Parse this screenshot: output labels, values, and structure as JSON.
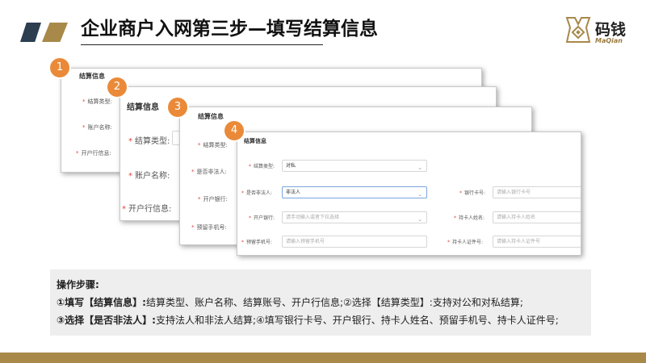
{
  "header": {
    "title": "企业商户入网第三步—填写结算信息",
    "logo_cn": "码钱",
    "logo_en": "MaQian"
  },
  "colors": {
    "accent_gold": "#a8894a",
    "accent_dark": "#2c3e50",
    "badge_orange": "#ea8a39",
    "required_red": "#e0453d"
  },
  "cards": {
    "c1": {
      "badge": "1",
      "title": "结算信息",
      "labels": [
        "结算类型:",
        "账户名称:",
        "开户行信息:"
      ]
    },
    "c2": {
      "badge": "2",
      "title": "结算信息",
      "labels": [
        "结算类型:",
        "账户名称:",
        "开户行信息:"
      ]
    },
    "c3": {
      "badge": "3",
      "title": "结算信息",
      "labels": [
        "结算类型:",
        "是否非法人:",
        "开户银行:",
        "预留手机号:"
      ]
    },
    "c4": {
      "badge": "4",
      "title": "结算信息",
      "settle_type_label": "结算类型:",
      "settle_type_value": "对私",
      "is_non_legal_label": "是否非法人:",
      "is_non_legal_value": "非法人",
      "bank_label": "开户银行:",
      "bank_placeholder": "请手动输入或者下拉选择",
      "phone_label": "预留手机号:",
      "phone_placeholder": "请输入预留手机号",
      "card_no_label": "银行卡号:",
      "card_no_placeholder": "请输入银行卡号",
      "holder_label": "持卡人姓名:",
      "holder_placeholder": "请输入持卡人姓名",
      "id_label": "持卡人证件号:",
      "id_placeholder": "请输入持卡人证件号"
    }
  },
  "steps": {
    "heading": "操作步骤:",
    "line1_bold": "①填写【结算信息】:",
    "line1_rest": "结算类型、账户名称、结算账号、开户行信息;②选择【结算类型】:支持对公和对私结算;",
    "line2_bold": "③选择【是否非法人】:",
    "line2_rest": "支持法人和非法人结算;④填写银行卡号、开户银行、持卡人姓名、预留手机号、持卡人证件号;"
  }
}
